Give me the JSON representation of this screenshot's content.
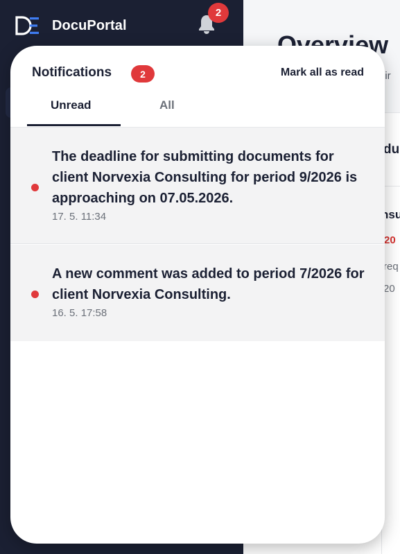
{
  "app": {
    "brand_name": "DocuPortal",
    "notification_count": "2"
  },
  "background": {
    "title": "Overview",
    "subtitle_fragment": "uir",
    "card_title_fragment": "du",
    "client_fragment": "nsu",
    "red_fragment": "20",
    "request_fragment": "req",
    "date_fragment": "20"
  },
  "notifications": {
    "title": "Notifications",
    "count": "2",
    "mark_all_label": "Mark all as read",
    "tabs": [
      {
        "label": "Unread",
        "active": true
      },
      {
        "label": "All",
        "active": false
      }
    ],
    "items": [
      {
        "text": "The deadline for submitting documents for client Norvexia Consulting for period 9/2026 is approaching on 07.05.2026.",
        "time": "17. 5. 11:34",
        "unread": true
      },
      {
        "text": "A new comment was added to period 7/2026 for client Norvexia Consulting.",
        "time": "16. 5. 17:58",
        "unread": true
      }
    ]
  },
  "colors": {
    "sidebar": "#1b2033",
    "accent_red": "#e0393b",
    "text_dark": "#1b2033",
    "text_muted": "#6b7079",
    "item_bg": "#f3f3f4"
  },
  "icons": {
    "logo": "docuportal-logo",
    "bell": "bell-icon",
    "unread_dot": "unread-dot-icon"
  }
}
